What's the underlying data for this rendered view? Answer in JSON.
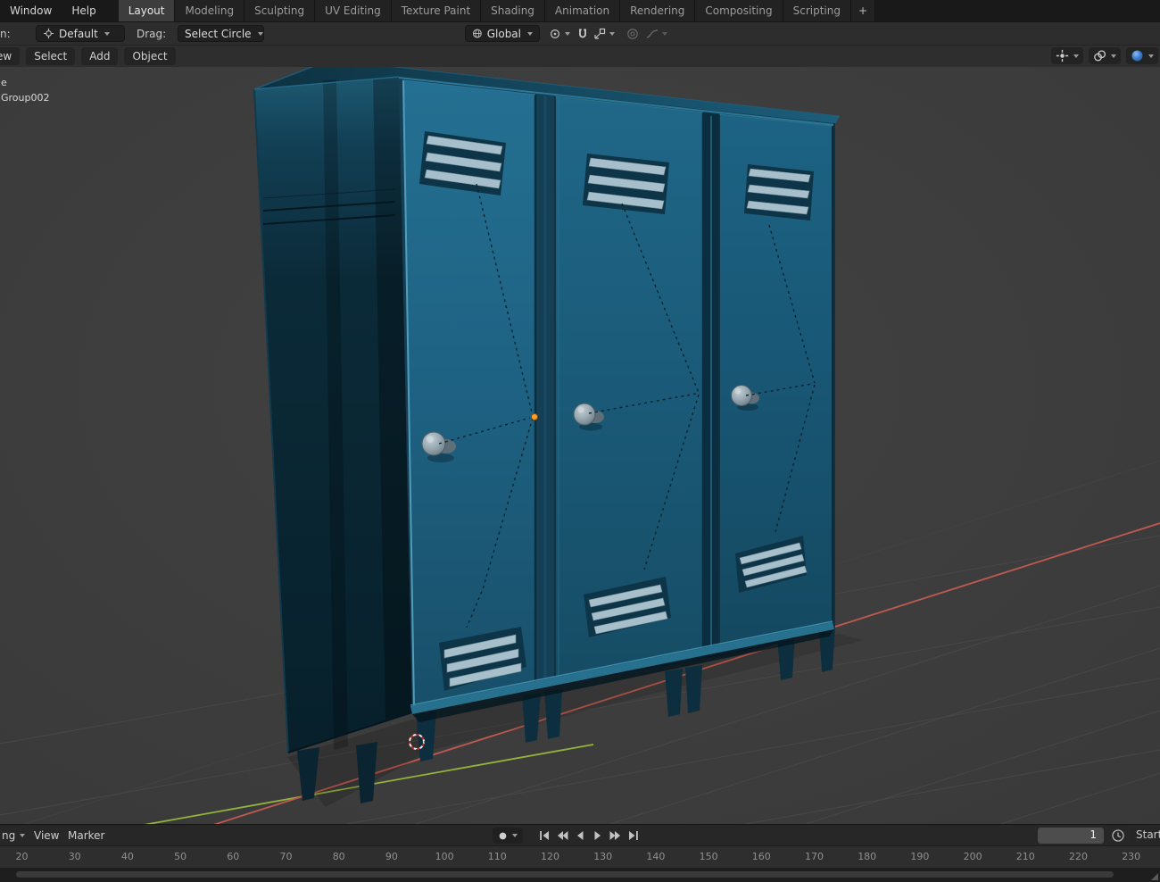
{
  "topbar": {
    "menus": {
      "window": "Window",
      "help": "Help"
    },
    "tabs": [
      {
        "label": "Layout",
        "active": true
      },
      {
        "label": "Modeling"
      },
      {
        "label": "Sculpting"
      },
      {
        "label": "UV Editing"
      },
      {
        "label": "Texture Paint"
      },
      {
        "label": "Shading"
      },
      {
        "label": "Animation"
      },
      {
        "label": "Rendering"
      },
      {
        "label": "Compositing"
      },
      {
        "label": "Scripting"
      }
    ],
    "add_tab": "+"
  },
  "tool_settings": {
    "label_cut": "n:",
    "orientation_value": "Default",
    "drag_label": "Drag:",
    "drag_value": "Select Circle",
    "transform_orientation": "Global"
  },
  "viewport": {
    "header": {
      "view_cut": "ew",
      "select": "Select",
      "add": "Add",
      "object": "Object"
    },
    "overlay": {
      "line1": "e",
      "line2": "Group002"
    }
  },
  "timeline": {
    "menu_cut": "ng",
    "view": "View",
    "marker": "Marker",
    "current_frame": "1",
    "start_label": "Start",
    "ticks": [
      "20",
      "30",
      "40",
      "50",
      "60",
      "70",
      "80",
      "90",
      "100",
      "110",
      "120",
      "130",
      "140",
      "150",
      "160",
      "170",
      "180",
      "190",
      "200",
      "210",
      "220",
      "230"
    ]
  },
  "colors": {
    "accent_blue": "#3f7fd0",
    "axis_x_red": "#c05a50",
    "axis_y_green": "#93b43c",
    "locker_front_teal": "#1d5f7e",
    "locker_side_dark": "#0b2733",
    "vent_gray": "#a6bfcb",
    "origin_orange": "#ff9e2c"
  }
}
